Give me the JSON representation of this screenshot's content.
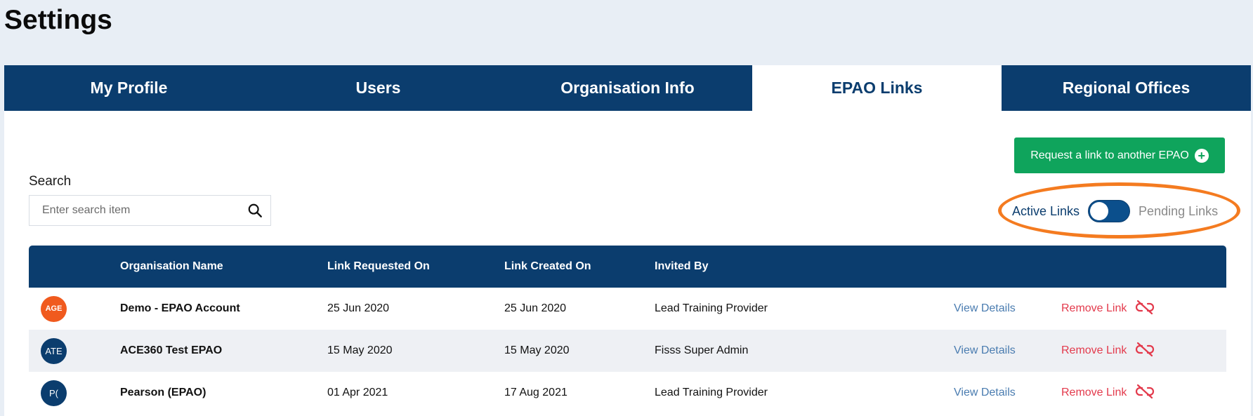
{
  "page": {
    "title": "Settings"
  },
  "tabs": [
    {
      "label": "My Profile",
      "active": false
    },
    {
      "label": "Users",
      "active": false
    },
    {
      "label": "Organisation Info",
      "active": false
    },
    {
      "label": "EPAO Links",
      "active": true
    },
    {
      "label": "Regional Offices",
      "active": false
    }
  ],
  "actions": {
    "request_link_label": "Request a link to another EPAO",
    "request_link_icon": "plus-circle-icon"
  },
  "search": {
    "label": "Search",
    "placeholder": "Enter search item",
    "value": ""
  },
  "toggle": {
    "left_label": "Active Links",
    "right_label": "Pending Links",
    "state": "Active Links"
  },
  "table": {
    "columns": [
      "",
      "Organisation Name",
      "Link Requested On",
      "Link Created On",
      "Invited By",
      "",
      ""
    ],
    "rows": [
      {
        "logo_text": "AGE",
        "name": "Demo - EPAO Account",
        "requested": "25 Jun 2020",
        "created": "25 Jun 2020",
        "invited_by": "Lead Training Provider",
        "view": "View Details",
        "remove": "Remove Link"
      },
      {
        "logo_text": "ATE",
        "name": "ACE360 Test EPAO",
        "requested": "15 May 2020",
        "created": "15 May 2020",
        "invited_by": "Fisss Super Admin",
        "view": "View Details",
        "remove": "Remove Link"
      },
      {
        "logo_text": "P(",
        "name": "Pearson (EPAO)",
        "requested": "01 Apr 2021",
        "created": "17 Aug 2021",
        "invited_by": "Lead Training Provider",
        "view": "View Details",
        "remove": "Remove Link"
      }
    ]
  },
  "colors": {
    "navy": "#0b3d6e",
    "green": "#0fa45c",
    "remove_red": "#e33a4c",
    "highlight_orange": "#f47b20",
    "link_blue": "#4a7cb0"
  }
}
